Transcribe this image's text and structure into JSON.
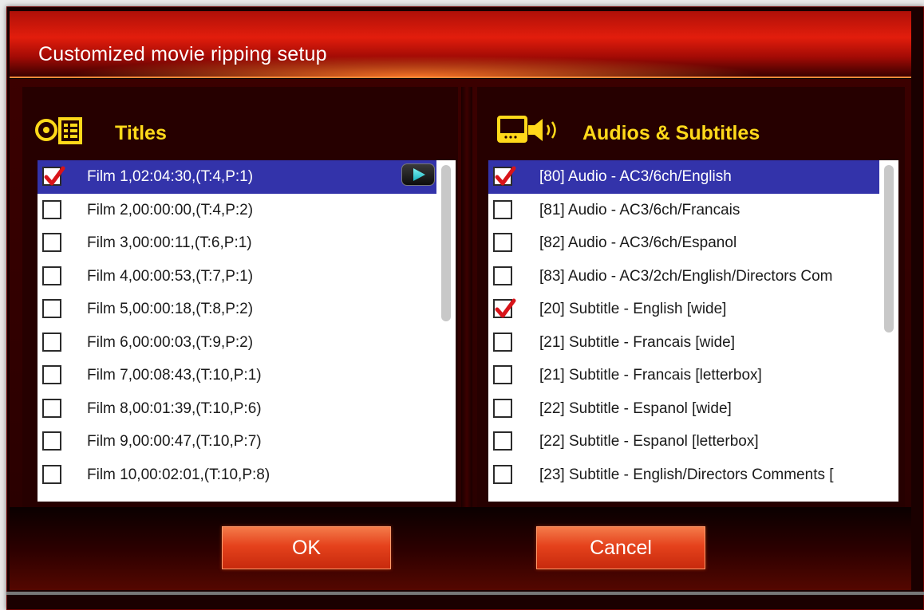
{
  "dialog": {
    "title": "Customized movie ripping setup",
    "colors": {
      "accent": "#e21d0c",
      "header_text": "#ffd91a",
      "selected_row": "#3333aa",
      "check": "#d8141a"
    }
  },
  "titles_panel": {
    "header": "Titles",
    "icon": "disc-list-icon",
    "items": [
      {
        "label": "Film 1,02:04:30,(T:4,P:1)",
        "checked": true,
        "selected": true
      },
      {
        "label": "Film 2,00:00:00,(T:4,P:2)",
        "checked": false,
        "selected": false
      },
      {
        "label": "Film 3,00:00:11,(T:6,P:1)",
        "checked": false,
        "selected": false
      },
      {
        "label": "Film 4,00:00:53,(T:7,P:1)",
        "checked": false,
        "selected": false
      },
      {
        "label": "Film 5,00:00:18,(T:8,P:2)",
        "checked": false,
        "selected": false
      },
      {
        "label": "Film 6,00:00:03,(T:9,P:2)",
        "checked": false,
        "selected": false
      },
      {
        "label": "Film 7,00:08:43,(T:10,P:1)",
        "checked": false,
        "selected": false
      },
      {
        "label": "Film 8,00:01:39,(T:10,P:6)",
        "checked": false,
        "selected": false
      },
      {
        "label": "Film 9,00:00:47,(T:10,P:7)",
        "checked": false,
        "selected": false
      },
      {
        "label": "Film 10,00:02:01,(T:10,P:8)",
        "checked": false,
        "selected": false
      }
    ]
  },
  "audio_panel": {
    "header": "Audios & Subtitles",
    "icon": "video-audio-icon",
    "items": [
      {
        "label": "[80] Audio - AC3/6ch/English",
        "checked": true,
        "selected": true
      },
      {
        "label": "[81] Audio - AC3/6ch/Francais",
        "checked": false,
        "selected": false
      },
      {
        "label": "[82] Audio - AC3/6ch/Espanol",
        "checked": false,
        "selected": false
      },
      {
        "label": "[83] Audio - AC3/2ch/English/Directors Com",
        "checked": false,
        "selected": false
      },
      {
        "label": "[20] Subtitle - English [wide]",
        "checked": true,
        "selected": false
      },
      {
        "label": "[21] Subtitle - Francais [wide]",
        "checked": false,
        "selected": false
      },
      {
        "label": "[21] Subtitle - Francais [letterbox]",
        "checked": false,
        "selected": false
      },
      {
        "label": "[22] Subtitle - Espanol [wide]",
        "checked": false,
        "selected": false
      },
      {
        "label": "[22] Subtitle - Espanol [letterbox]",
        "checked": false,
        "selected": false
      },
      {
        "label": "[23] Subtitle - English/Directors Comments [",
        "checked": false,
        "selected": false
      }
    ]
  },
  "buttons": {
    "ok": "OK",
    "cancel": "Cancel"
  }
}
